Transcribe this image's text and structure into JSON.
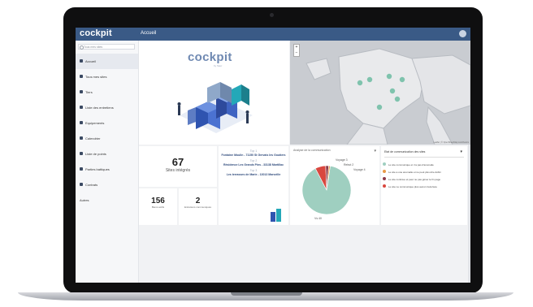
{
  "app": {
    "logo": "cockpit",
    "page_title": "Accueil"
  },
  "sidebar": {
    "search_placeholder": "Tous mes sites",
    "items": [
      {
        "label": "Accueil",
        "icon": "home-icon"
      },
      {
        "label": "Tous mes sites",
        "icon": "building-icon"
      },
      {
        "label": "Tiers",
        "icon": "users-icon"
      },
      {
        "label": "Liste des entretiens",
        "icon": "list-icon"
      },
      {
        "label": "Equipements",
        "icon": "equipment-icon"
      },
      {
        "label": "Calendrier",
        "icon": "calendar-icon"
      },
      {
        "label": "Liste de points",
        "icon": "pin-icon"
      },
      {
        "label": "Parties battiques",
        "icon": "building-parts-icon"
      },
      {
        "label": "Contrats",
        "icon": "contract-icon"
      },
      {
        "label": "Autres",
        "icon": "more-icon"
      }
    ]
  },
  "brand": {
    "title": "cockpit",
    "subtitle": "by Saur"
  },
  "stats": {
    "sites_value": "67",
    "sites_label": "Sites intégrés",
    "small1_value": "156",
    "small1_label": "Biens actifs",
    "small2_value": "2",
    "small2_label": "Entretiens communiqués"
  },
  "top_sites": [
    {
      "rank": "Top 1",
      "name": "Fontaine Moulin - 71150 St Gervais les Goutiers"
    },
    {
      "rank": "Top 2",
      "name": "Résidence Les Grands Pins - 33138 Martillac"
    },
    {
      "rank": "Top 3",
      "name": "Les terrasses de Marie - 13013 Marseille"
    }
  ],
  "pie_card": {
    "title": "Analyse de la communication",
    "label_top": "Voyage 3",
    "label_mid": "Rebut 2",
    "label_small": "Voyage 4",
    "label_bottom": "Vs 40"
  },
  "legend": {
    "dropdown": "Etat de communication des sites",
    "items": [
      {
        "label": "Le site communique et n'a pas d'anomalie",
        "color": "#9fcfc0"
      },
      {
        "label": "Le site a une anomalie et ne peut plus être défini",
        "color": "#e89a48"
      },
      {
        "label": "Le site continue et peut ne pas gêner le fin page",
        "color": "#8b3a4a"
      },
      {
        "label": "Le site ne communique plus aucun Cela face",
        "color": "#d9473f"
      }
    ]
  },
  "map": {
    "attribution": "Leaflet | © OpenStreetMap contributors"
  },
  "chart_data": {
    "type": "pie",
    "slices": [
      {
        "label": "Vs 40",
        "value": 90,
        "color": "#9fcfc0"
      },
      {
        "label": "Voyage 3",
        "value": 7,
        "color": "#d9473f"
      },
      {
        "label": "Rebut 2",
        "value": 2,
        "color": "#8b3a4a"
      },
      {
        "label": "Voyage 4",
        "value": 1,
        "color": "#e89a48"
      }
    ]
  }
}
